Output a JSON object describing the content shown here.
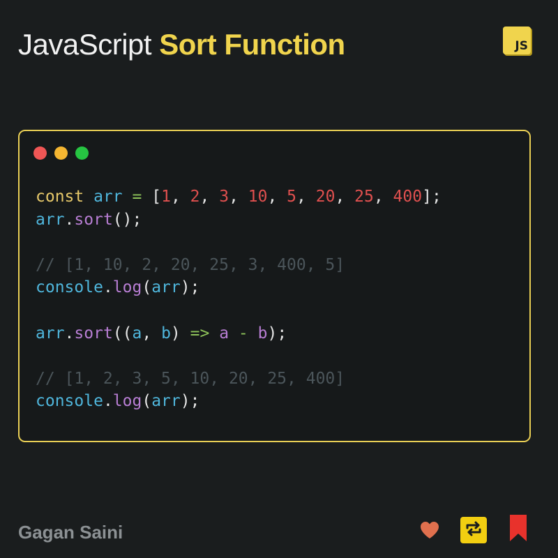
{
  "header": {
    "title_plain": "JavaScript",
    "title_accent": "Sort Function",
    "badge_text": "JS"
  },
  "code_window": {
    "controls": [
      "close",
      "minimize",
      "maximize"
    ],
    "lines": [
      [
        {
          "t": "kw",
          "v": "const"
        },
        {
          "t": "punc",
          "v": " "
        },
        {
          "t": "var",
          "v": "arr"
        },
        {
          "t": "punc",
          "v": " "
        },
        {
          "t": "op",
          "v": "="
        },
        {
          "t": "punc",
          "v": " ["
        },
        {
          "t": "num",
          "v": "1"
        },
        {
          "t": "punc",
          "v": ", "
        },
        {
          "t": "num",
          "v": "2"
        },
        {
          "t": "punc",
          "v": ", "
        },
        {
          "t": "num",
          "v": "3"
        },
        {
          "t": "punc",
          "v": ", "
        },
        {
          "t": "num",
          "v": "10"
        },
        {
          "t": "punc",
          "v": ", "
        },
        {
          "t": "num",
          "v": "5"
        },
        {
          "t": "punc",
          "v": ", "
        },
        {
          "t": "num",
          "v": "20"
        },
        {
          "t": "punc",
          "v": ", "
        },
        {
          "t": "num",
          "v": "25"
        },
        {
          "t": "punc",
          "v": ", "
        },
        {
          "t": "num",
          "v": "400"
        },
        {
          "t": "punc",
          "v": "];"
        }
      ],
      [
        {
          "t": "var",
          "v": "arr"
        },
        {
          "t": "punc",
          "v": "."
        },
        {
          "t": "fn",
          "v": "sort"
        },
        {
          "t": "punc",
          "v": "();"
        }
      ],
      [],
      [
        {
          "t": "cmt",
          "v": "// [1, 10, 2, 20, 25, 3, 400, 5]"
        }
      ],
      [
        {
          "t": "var",
          "v": "console"
        },
        {
          "t": "punc",
          "v": "."
        },
        {
          "t": "fn",
          "v": "log"
        },
        {
          "t": "punc",
          "v": "("
        },
        {
          "t": "var",
          "v": "arr"
        },
        {
          "t": "punc",
          "v": ");"
        }
      ],
      [],
      [
        {
          "t": "var",
          "v": "arr"
        },
        {
          "t": "punc",
          "v": "."
        },
        {
          "t": "fn",
          "v": "sort"
        },
        {
          "t": "punc",
          "v": "(("
        },
        {
          "t": "var",
          "v": "a"
        },
        {
          "t": "punc",
          "v": ", "
        },
        {
          "t": "var",
          "v": "b"
        },
        {
          "t": "punc",
          "v": ") "
        },
        {
          "t": "op",
          "v": "=>"
        },
        {
          "t": "punc",
          "v": " "
        },
        {
          "t": "param",
          "v": "a"
        },
        {
          "t": "punc",
          "v": " "
        },
        {
          "t": "op",
          "v": "-"
        },
        {
          "t": "punc",
          "v": " "
        },
        {
          "t": "param",
          "v": "b"
        },
        {
          "t": "punc",
          "v": ");"
        }
      ],
      [],
      [
        {
          "t": "cmt",
          "v": "// [1, 2, 3, 5, 10, 20, 25, 400]"
        }
      ],
      [
        {
          "t": "var",
          "v": "console"
        },
        {
          "t": "punc",
          "v": "."
        },
        {
          "t": "fn",
          "v": "log"
        },
        {
          "t": "punc",
          "v": "("
        },
        {
          "t": "var",
          "v": "arr"
        },
        {
          "t": "punc",
          "v": ");"
        }
      ]
    ]
  },
  "footer": {
    "author": "Gagan Saini",
    "actions": [
      {
        "name": "like",
        "icon": "heart-icon",
        "color": "#e0704e"
      },
      {
        "name": "repost",
        "icon": "repost-icon",
        "color": "#f2ce11"
      },
      {
        "name": "bookmark",
        "icon": "bookmark-icon",
        "color": "#e8322c"
      }
    ]
  },
  "colors": {
    "background": "#1a1d1e",
    "accent": "#f0d44d",
    "window_border": "#e9cf55"
  }
}
